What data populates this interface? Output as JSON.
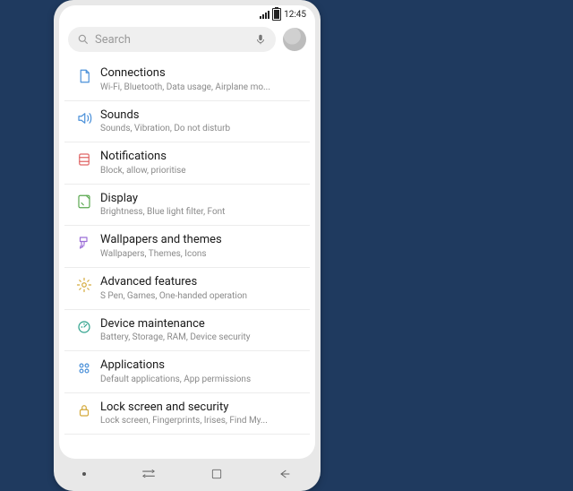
{
  "status": {
    "time": "12:45"
  },
  "search": {
    "placeholder": "Search"
  },
  "items": [
    {
      "id": "connections",
      "title": "Connections",
      "sub": "Wi-Fi, Bluetooth, Data usage, Airplane mo...",
      "icon": "doc",
      "color": "#4a90d9"
    },
    {
      "id": "sounds",
      "title": "Sounds",
      "sub": "Sounds, Vibration, Do not disturb",
      "icon": "speaker",
      "color": "#4a90d9"
    },
    {
      "id": "notifications",
      "title": "Notifications",
      "sub": "Block, allow, prioritise",
      "icon": "notif",
      "color": "#e06666"
    },
    {
      "id": "display",
      "title": "Display",
      "sub": "Brightness, Blue light filter, Font",
      "icon": "display",
      "color": "#5aa84f"
    },
    {
      "id": "wallpapers",
      "title": "Wallpapers and themes",
      "sub": "Wallpapers, Themes, Icons",
      "icon": "brush",
      "color": "#9b6dd7"
    },
    {
      "id": "advanced",
      "title": "Advanced features",
      "sub": "S Pen, Games, One-handed operation",
      "icon": "gear",
      "color": "#d4a93a"
    },
    {
      "id": "maintenance",
      "title": "Device maintenance",
      "sub": "Battery, Storage, RAM, Device security",
      "icon": "meter",
      "color": "#2aa08a"
    },
    {
      "id": "applications",
      "title": "Applications",
      "sub": "Default applications, App permissions",
      "icon": "apps",
      "color": "#4a90d9"
    },
    {
      "id": "lockscreen",
      "title": "Lock screen and security",
      "sub": "Lock screen, Fingerprints, Irises, Find My...",
      "icon": "lock",
      "color": "#d4a93a"
    }
  ]
}
